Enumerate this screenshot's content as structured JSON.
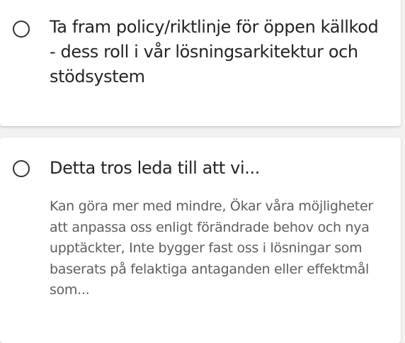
{
  "tasks": [
    {
      "title": "Ta fram policy/riktlinje för öppen källkod - dess roll i vår lösningsarkitektur och stödsystem",
      "description": ""
    },
    {
      "title": "Detta tros leda till att vi...",
      "description": "Kan göra mer med mindre, Ökar våra möjligheter att anpassa oss enligt förändrade behov och nya upptäckter, Inte bygger fast oss i lösningar som baserats på felaktiga antaganden eller effektmål som..."
    }
  ]
}
